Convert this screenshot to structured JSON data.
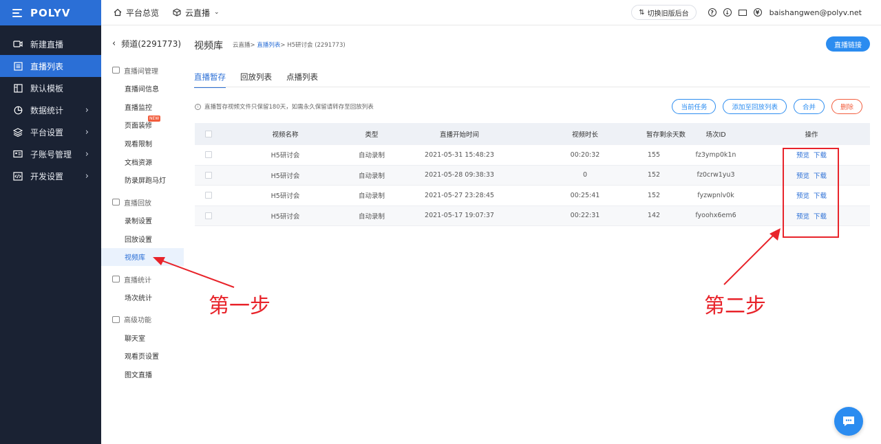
{
  "app": {
    "brand": "POLYV"
  },
  "nav": {
    "items": [
      {
        "label": "新建直播",
        "icon": "video-icon",
        "has_children": false,
        "active": false
      },
      {
        "label": "直播列表",
        "icon": "list-icon",
        "has_children": false,
        "active": true
      },
      {
        "label": "默认模板",
        "icon": "template-icon",
        "has_children": false,
        "active": false
      },
      {
        "label": "数据统计",
        "icon": "chart-icon",
        "has_children": true,
        "active": false
      },
      {
        "label": "平台设置",
        "icon": "layers-icon",
        "has_children": true,
        "active": false
      },
      {
        "label": "子账号管理",
        "icon": "id-card-icon",
        "has_children": true,
        "active": false
      },
      {
        "label": "开发设置",
        "icon": "code-icon",
        "has_children": true,
        "active": false
      }
    ]
  },
  "topbar": {
    "home": "平台总览",
    "product": "云直播",
    "switch_label": "切换旧版后台",
    "email": "baishangwen@polyv.net"
  },
  "subnav": {
    "back_label": "频道(2291773)",
    "groups": [
      {
        "title": "直播间管理",
        "items": [
          {
            "label": "直播间信息"
          },
          {
            "label": "直播监控"
          },
          {
            "label": "页面装修",
            "badge": "NEW"
          },
          {
            "label": "观看限制"
          },
          {
            "label": "文档资源"
          },
          {
            "label": "防录屏跑马灯"
          }
        ]
      },
      {
        "title": "直播回放",
        "items": [
          {
            "label": "录制设置"
          },
          {
            "label": "回放设置"
          },
          {
            "label": "视频库",
            "active": true
          }
        ]
      },
      {
        "title": "直播统计",
        "items": [
          {
            "label": "场次统计"
          }
        ]
      },
      {
        "title": "高级功能",
        "items": [
          {
            "label": "聊天室"
          },
          {
            "label": "观看页设置"
          },
          {
            "label": "图文直播"
          }
        ]
      }
    ]
  },
  "main": {
    "title": "视频库",
    "breadcrumb": {
      "a": "云直播",
      "sep": ">",
      "b": "直播列表",
      "c": "H5研讨会 (2291773)"
    },
    "live_link_label": "直播链接",
    "tabs": [
      {
        "label": "直播暂存",
        "active": true
      },
      {
        "label": "回放列表"
      },
      {
        "label": "点播列表"
      }
    ],
    "notice": "直播暂存视频文件只保留180天，如需永久保留请转存至回放列表",
    "actions": [
      {
        "label": "当前任务"
      },
      {
        "label": "添加至回放列表"
      },
      {
        "label": "合并"
      },
      {
        "label": "删除",
        "danger": true
      }
    ],
    "table": {
      "headers": {
        "name": "视频名称",
        "type": "类型",
        "start": "直播开始时间",
        "duration": "视频时长",
        "days": "暂存剩余天数",
        "id": "场次ID",
        "ops": "操作"
      },
      "rows": [
        {
          "name": "H5研讨会",
          "type": "自动录制",
          "start": "2021-05-31 15:48:23",
          "duration": "00:20:32",
          "days": "155",
          "id": "fz3ymp0k1n"
        },
        {
          "name": "H5研讨会",
          "type": "自动录制",
          "start": "2021-05-28 09:38:33",
          "duration": "0",
          "days": "152",
          "id": "fz0crw1yu3"
        },
        {
          "name": "H5研讨会",
          "type": "自动录制",
          "start": "2021-05-27 23:28:45",
          "duration": "00:25:41",
          "days": "152",
          "id": "fyzwpnlv0k"
        },
        {
          "name": "H5研讨会",
          "type": "自动录制",
          "start": "2021-05-17 19:07:37",
          "duration": "00:22:31",
          "days": "142",
          "id": "fyoohx6em6"
        }
      ],
      "op_preview": "预览",
      "op_download": "下载"
    }
  },
  "annotations": {
    "step1": "第一步",
    "step2": "第二步",
    "color": "#e8232a"
  }
}
